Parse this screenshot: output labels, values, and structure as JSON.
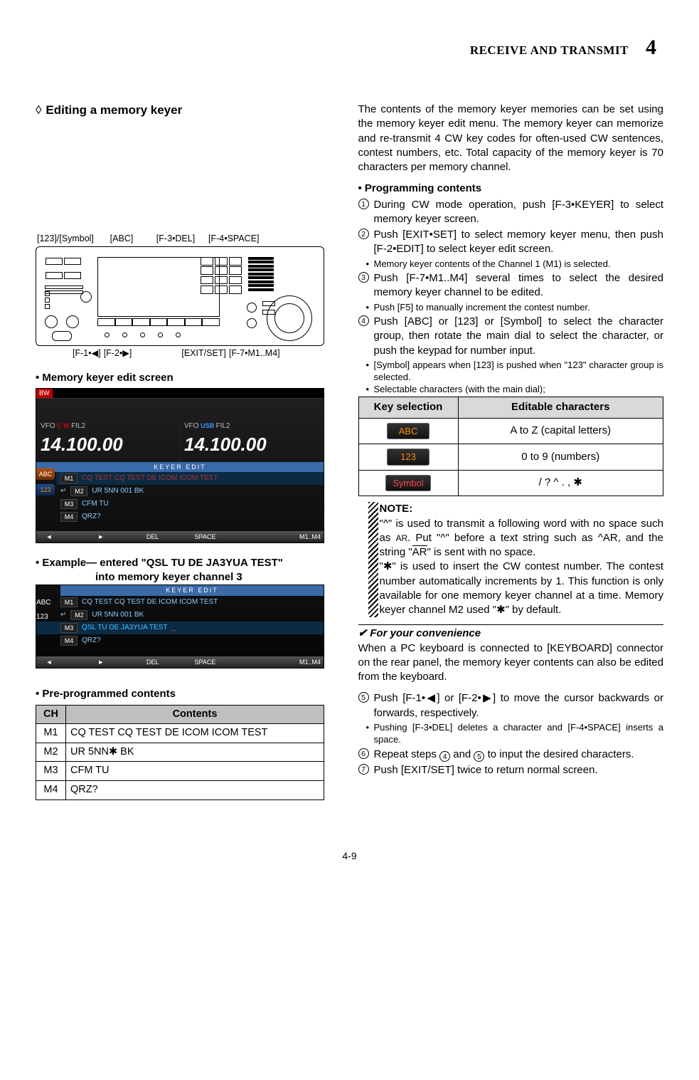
{
  "header": {
    "section": "RECEIVE AND TRANSMIT",
    "chapter": "4"
  },
  "heading": {
    "diamond": "◊",
    "text": "Editing a memory keyer"
  },
  "annot_top": {
    "a": "[123]/[Symbol]",
    "b": "[ABC]",
    "c": "[F-3•DEL]",
    "d": "[F-4•SPACE]"
  },
  "annot_bot": {
    "a": "[F-1•◀]",
    "b": "[F-2•▶]",
    "c": "[EXIT/SET]",
    "d": "[F-7•M1..M4]"
  },
  "shot1_head": "• Memory keyer edit screen",
  "shot1": {
    "vfo_label": "VFO",
    "cw": "C W",
    "fil2_l": "FIL2",
    "usb": "USB",
    "fil2_r": "FIL2",
    "freq_l": "14.100.00",
    "freq_r": "14.100.00",
    "ke_label": "KEYER  EDIT",
    "m1": {
      "k": "M1",
      "t": "CQ TEST CQ TEST DE ICOM ICOM TEST"
    },
    "m2": {
      "k": "M2",
      "t": "UR 5NN 001 BK",
      "icon": "↵"
    },
    "m3": {
      "k": "M3",
      "t": "CFM TU"
    },
    "m4": {
      "k": "M4",
      "t": "QRZ?"
    },
    "tabs": {
      "abc": "ABC",
      "n123": "123"
    },
    "soft": {
      "left": "◄",
      "right": "►",
      "del": "DEL",
      "space": "SPACE",
      "last": "M1..M4"
    }
  },
  "ex_head_l1": "• Example— entered \"QSL TU DE JA3YUA TEST\"",
  "ex_head_l2": "into memory keyer channel 3",
  "shot2": {
    "ke_label": "KEYER  EDIT",
    "m1": {
      "k": "M1",
      "t": "CQ TEST CQ TEST DE ICOM ICOM TEST"
    },
    "m2": {
      "k": "M2",
      "t": "UR 5NN 001 BK",
      "icon": "↵"
    },
    "m3": {
      "k": "M3",
      "t": "QSL TU DE JA3YUA TEST",
      "cursor": "_"
    },
    "m4": {
      "k": "M4",
      "t": "QRZ?"
    },
    "tabs": {
      "abc": "ABC",
      "n123": "123"
    },
    "soft": {
      "left": "◄",
      "right": "►",
      "del": "DEL",
      "space": "SPACE",
      "last": "M1..M4"
    }
  },
  "preprog_head": "• Pre-programmed contents",
  "pre_table": {
    "h1": "CH",
    "h2": "Contents",
    "rows": [
      {
        "ch": "M1",
        "c": "CQ TEST CQ TEST DE ICOM ICOM TEST"
      },
      {
        "ch": "M2",
        "c": "UR 5NN✱ BK"
      },
      {
        "ch": "M3",
        "c": "CFM TU"
      },
      {
        "ch": "M4",
        "c": "QRZ?"
      }
    ]
  },
  "intro": "The contents of the memory keyer memories can be set using the memory keyer edit menu. The memory keyer can memorize and re-transmit 4 CW key codes for often-used CW sentences, contest numbers, etc. Total capacity of the memory keyer is 70 characters per memory channel.",
  "prog_head": "• Programming contents",
  "steps": {
    "s1": "During CW mode operation, push [F-3•KEYER] to select memory keyer screen.",
    "s2": "Push [EXIT•SET] to select memory keyer menu, then push [F-2•EDIT] to select keyer edit screen.",
    "s2b": "Memory keyer contents of the Channel 1 (M1) is selected.",
    "s3": "Push [F-7•M1..M4] several times to select the desired memory keyer channel to be edited.",
    "s3b": "Push [F5] to manually increment the contest number.",
    "s4": "Push [ABC] or [123] or [Symbol] to select the character group, then rotate the main dial to select the character, or push the keypad for number input.",
    "s4b1": "[Symbol] appears when [123] is pushed when \"123\" character group is selected.",
    "s4b2": "Selectable characters (with the main dial);",
    "s5": "Push [F-1•◀] or [F-2•▶] to move the cursor backwards or forwards, respectively.",
    "s5b": "Pushing [F-3•DEL] deletes a character and [F-4•SPACE] inserts a space.",
    "s6a": "Repeat steps ",
    "s6_ref1": "4",
    "s6mid": " and ",
    "s6_ref2": "5",
    "s6b": " to input the desired characters.",
    "s7": "Push [EXIT/SET] twice to return normal screen."
  },
  "key_table": {
    "h1": "Key selection",
    "h2": "Editable characters",
    "r1": {
      "badge": "ABC",
      "val": "A to Z (capital letters)"
    },
    "r2": {
      "badge": "123",
      "val": "0 to 9 (numbers)"
    },
    "r3": {
      "badge": "Symbol",
      "val": "/  ? ^ . , ✱"
    }
  },
  "note": {
    "head": "NOTE:",
    "p1a": "\"^\" is used to transmit a following word with no space such as ",
    "p1b": "AR",
    "p1c": ". Put \"^\" before a text string such as ^AR, and the string \"",
    "p1d": "AR",
    "p1e": "\" is sent with no space.",
    "p2": "\"✱\" is used to insert the CW contest number. The contest number automatically increments by 1. This function is only available for one memory keyer channel at a time. Memory keyer channel M2 used \"✱\" by default."
  },
  "conv": {
    "check": "✔",
    "head": " For your convenience",
    "body": "When a PC keyboard is connected to [KEYBOARD] connector on the rear panel, the memory keyer contents can also be edited from the keyboard."
  },
  "footer": "4-9"
}
